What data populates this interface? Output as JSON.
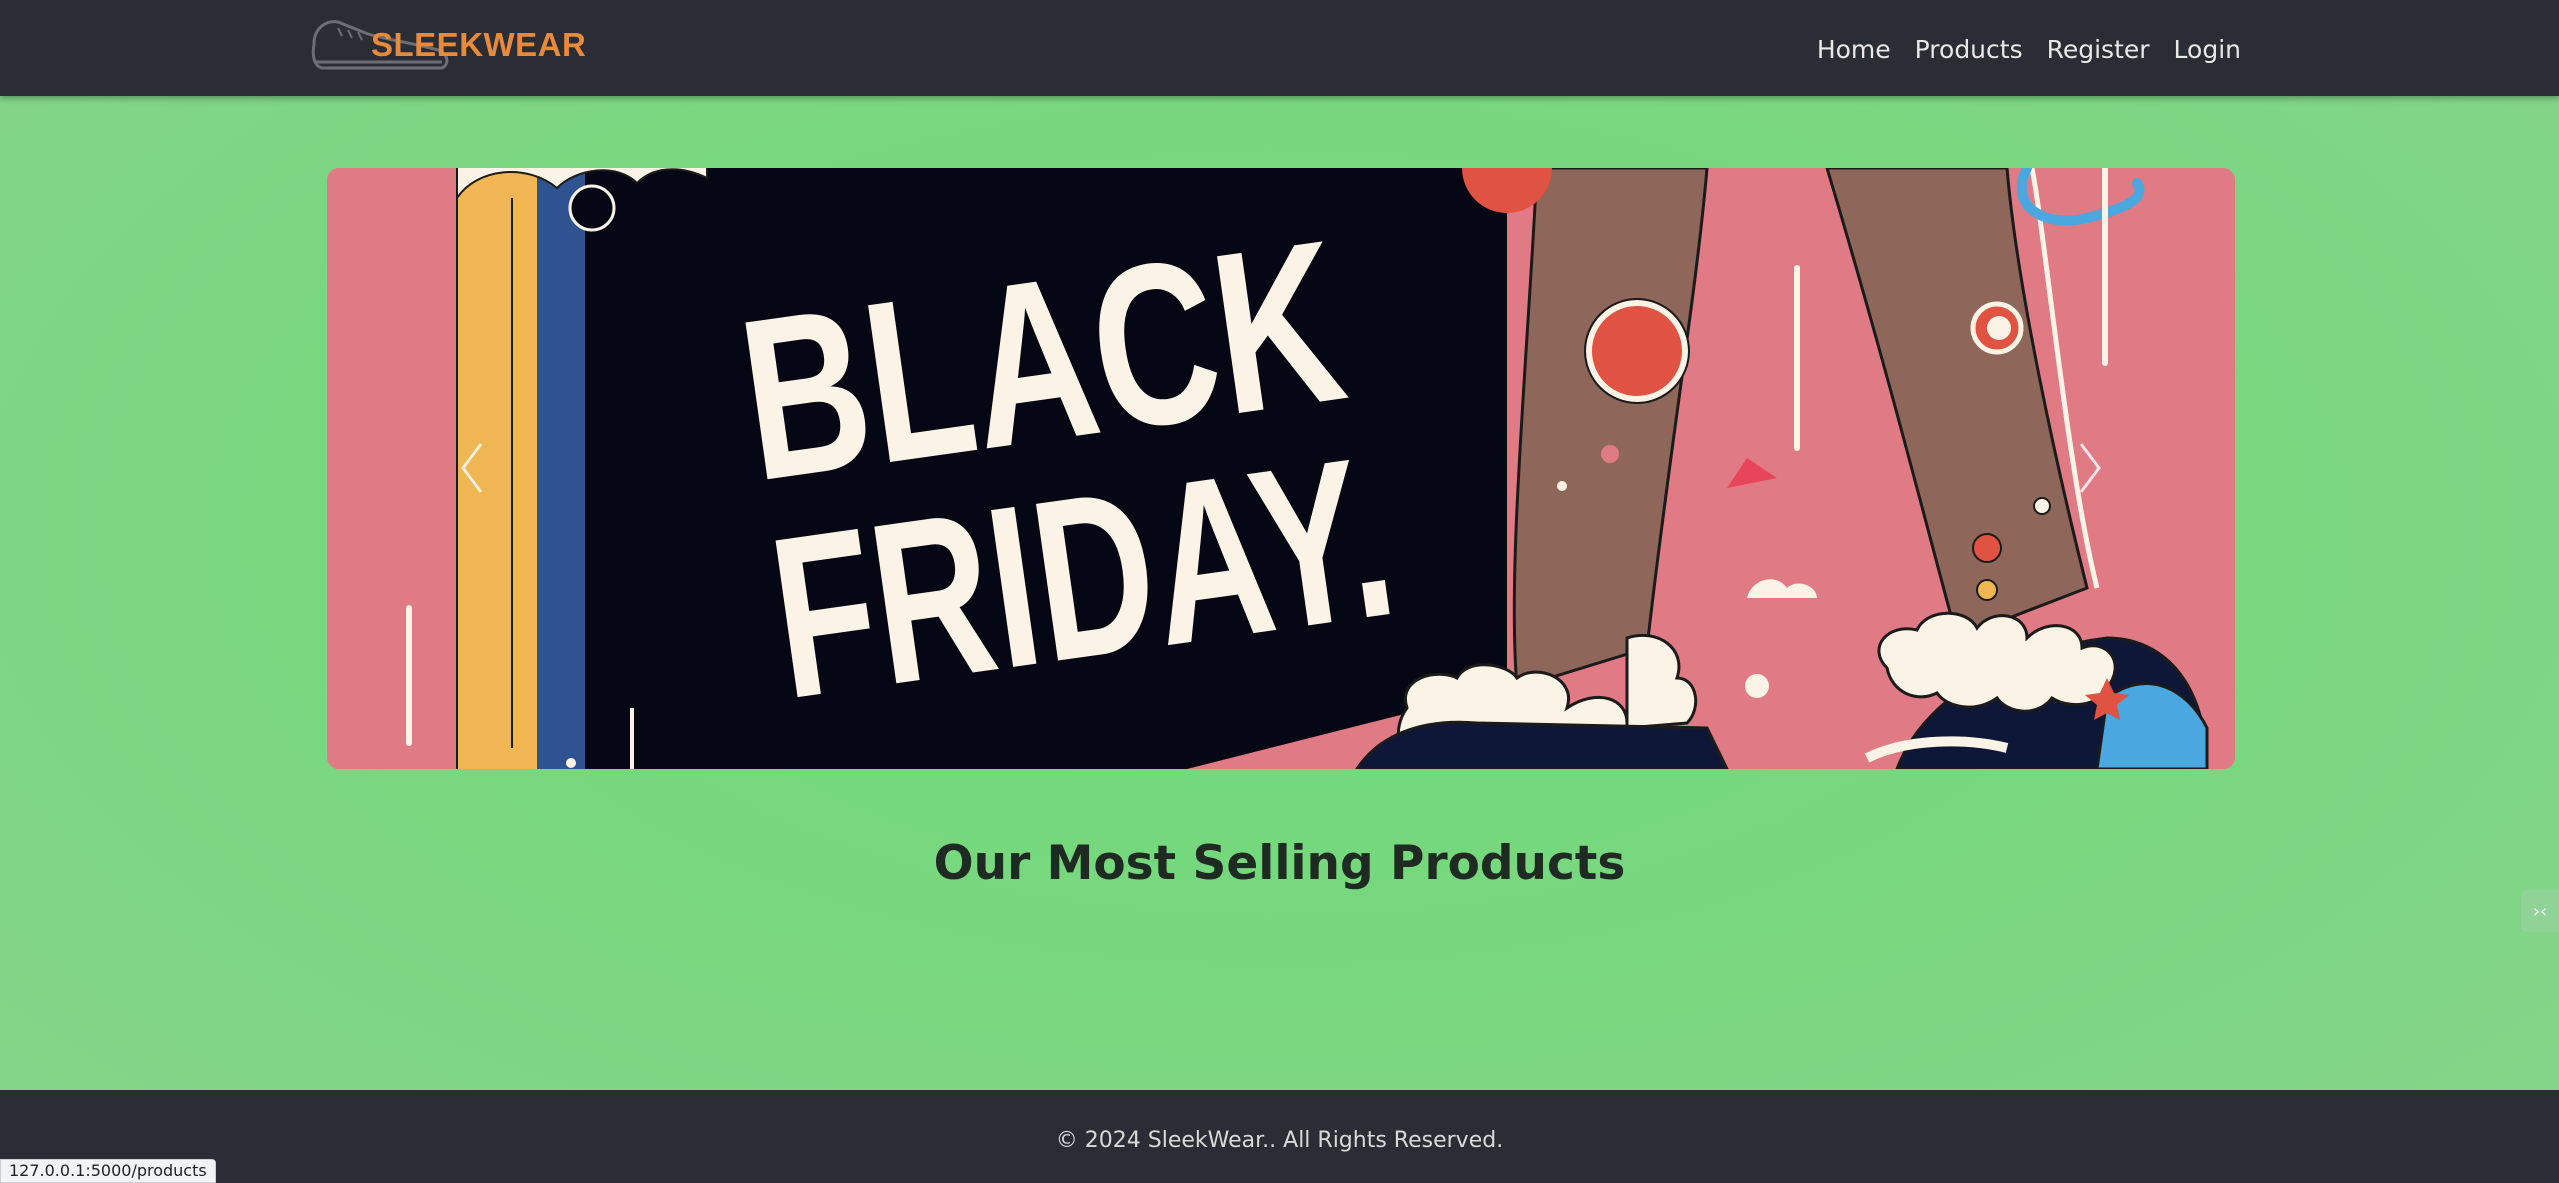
{
  "brand": {
    "name": "SLEEKWEAR",
    "logo_icon": "sneaker-icon",
    "color": "#e88a3c"
  },
  "nav": {
    "items": [
      {
        "label": "Home"
      },
      {
        "label": "Products"
      },
      {
        "label": "Register"
      },
      {
        "label": "Login"
      }
    ]
  },
  "carousel": {
    "slide_text_line1": "BLACK",
    "slide_text_line2": "FRIDAY.",
    "prev_icon": "chevron-left-icon",
    "next_icon": "chevron-right-icon"
  },
  "main": {
    "section_title": "Our Most Selling Products"
  },
  "footer": {
    "copyright": "© 2024 SleekWear.. All Rights Reserved."
  },
  "status_bar": {
    "url": "127.0.0.1:5000/products"
  },
  "colors": {
    "navbar_bg": "#2a2d33",
    "page_bg": "#79d77f",
    "banner_pink": "#e07b86",
    "banner_dark": "#050814"
  }
}
